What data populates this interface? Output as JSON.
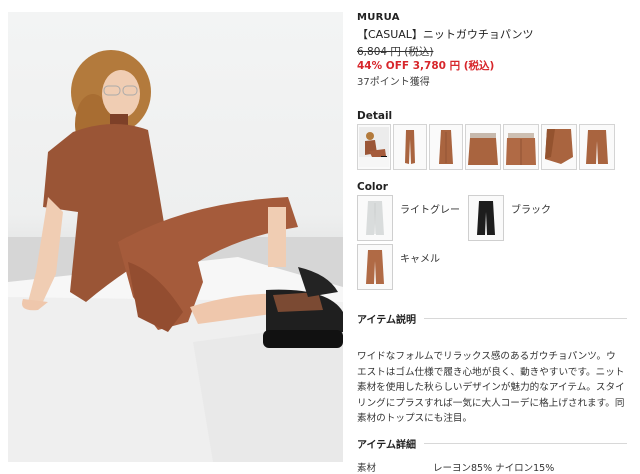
{
  "product": {
    "brand": "MURUA",
    "name": "【CASUAL】ニットガウチョパンツ",
    "price_original": "6,804 円 (税込)",
    "price_sale": "44% OFF 3,780 円 (税込)",
    "points": "37ポイント獲得"
  },
  "detail": {
    "title": "Detail",
    "thumbnails": [
      "model-full-view",
      "pants-front",
      "pants-side",
      "waist-closeup",
      "fabric-closeup",
      "hem-closeup"
    ]
  },
  "colors": {
    "title": "Color",
    "options": [
      {
        "label": "ライトグレー",
        "swatch_color": "#d9dcdc"
      },
      {
        "label": "ブラック",
        "swatch_color": "#1d1d1d"
      },
      {
        "label": "キャメル",
        "swatch_color": "#b06a45"
      }
    ]
  },
  "item_description": {
    "title": "アイテム説明",
    "text": "ワイドなフォルムでリラックス感のあるガウチョパンツ。ウエストはゴム仕様で履き心地が良く、動きやすいです。ニット素材を使用した秋らしいデザインが魅力的なアイテム。スタイリングにプラスすれば一気に大人コーデに格上げされます。同素材のトップスにも注目。"
  },
  "item_details": {
    "title": "アイテム詳細",
    "material_row": "素材　　　　　　レーヨン85% ナイロン15%"
  },
  "palette": {
    "camel": "#a9643f",
    "sale_red": "#d7262b"
  }
}
